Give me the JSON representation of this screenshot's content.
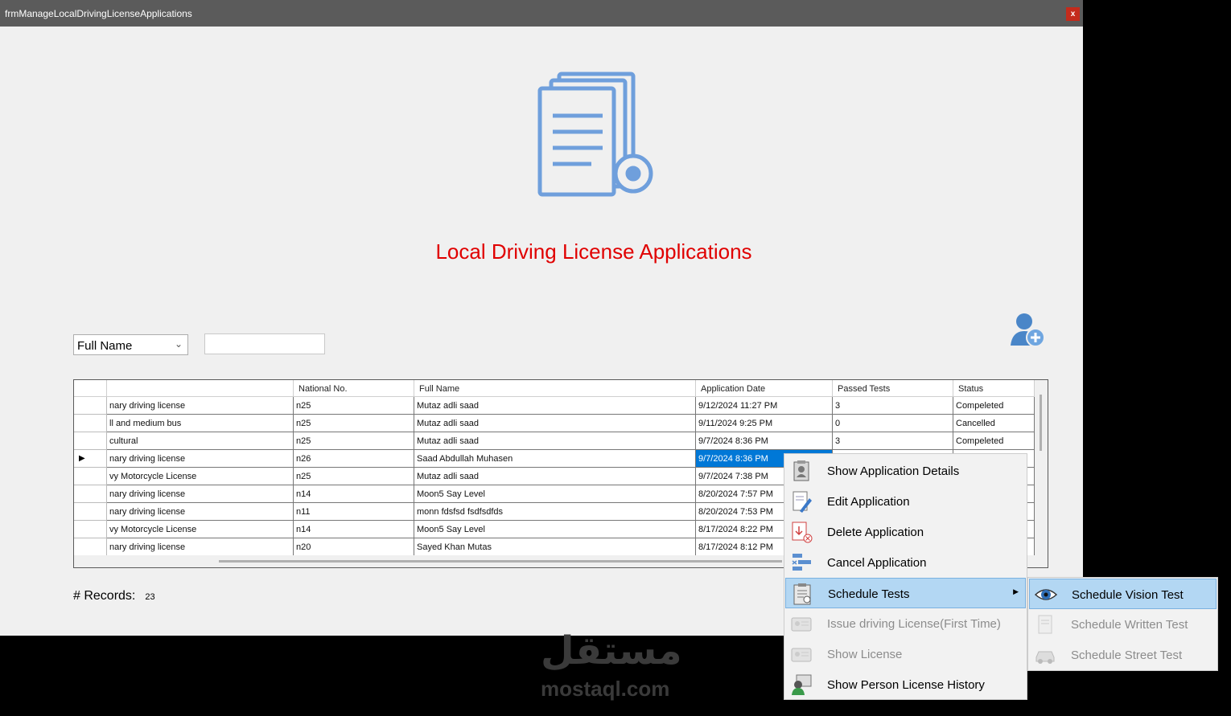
{
  "window": {
    "title": "frmManageLocalDrivingLicenseApplications",
    "close_label": "x"
  },
  "header": {
    "title": "Local Driving License Applications"
  },
  "filter": {
    "selected": "Full Name",
    "value": ""
  },
  "grid": {
    "columns": [
      "",
      "National No.",
      "Full Name",
      "Application Date",
      "Passed Tests",
      "Status"
    ],
    "rows": [
      {
        "marker": "",
        "class": "nary driving license",
        "national": "n25",
        "name": "Mutaz adli  saad",
        "date": "9/12/2024 11:27 PM",
        "passed": "3",
        "status": "Compeleted"
      },
      {
        "marker": "",
        "class": "ll and medium bus",
        "national": "n25",
        "name": "Mutaz adli  saad",
        "date": "9/11/2024 9:25 PM",
        "passed": "0",
        "status": "Cancelled"
      },
      {
        "marker": "",
        "class": "cultural",
        "national": "n25",
        "name": "Mutaz adli  saad",
        "date": "9/7/2024 8:36 PM",
        "passed": "3",
        "status": "Compeleted"
      },
      {
        "marker": "▶",
        "class": "nary driving license",
        "national": "n26",
        "name": "Saad Abdullah  Muhasen",
        "date": "9/7/2024 8:36 PM",
        "passed": "",
        "status": ""
      },
      {
        "marker": "",
        "class": "vy Motorcycle License",
        "national": "n25",
        "name": "Mutaz adli  saad",
        "date": "9/7/2024 7:38 PM",
        "passed": "",
        "status": ""
      },
      {
        "marker": "",
        "class": "nary driving license",
        "national": "n14",
        "name": "Moon5 Say  Level",
        "date": "8/20/2024 7:57 PM",
        "passed": "",
        "status": ""
      },
      {
        "marker": "",
        "class": "nary driving license",
        "national": "n11",
        "name": "monn fdsfsd  fsdfsdfds",
        "date": "8/20/2024 7:53 PM",
        "passed": "",
        "status": ""
      },
      {
        "marker": "",
        "class": "vy Motorcycle License",
        "national": "n14",
        "name": "Moon5 Say  Level",
        "date": "8/17/2024 8:22 PM",
        "passed": "",
        "status": ""
      },
      {
        "marker": "",
        "class": "nary driving license",
        "national": "n20",
        "name": "Sayed Khan  Mutas",
        "date": "8/17/2024 8:12 PM",
        "passed": "",
        "status": ""
      }
    ]
  },
  "records": {
    "label": "# Records:",
    "count": "23"
  },
  "context_menu": {
    "items": [
      {
        "label": "Show Application Details",
        "icon": "id-card-icon",
        "enabled": true
      },
      {
        "label": "Edit Application",
        "icon": "edit-document-icon",
        "enabled": true
      },
      {
        "label": "Delete Application",
        "icon": "delete-document-icon",
        "enabled": true
      },
      {
        "label": "Cancel  Application",
        "icon": "cancel-list-icon",
        "enabled": true
      },
      {
        "label": "Schedule Tests",
        "icon": "schedule-clipboard-icon",
        "enabled": true,
        "highlighted": true
      },
      {
        "label": "Issue driving License(First Time)",
        "icon": "license-card-icon",
        "enabled": false
      },
      {
        "label": "Show License",
        "icon": "license-card-icon",
        "enabled": false
      },
      {
        "label": "Show Person License History",
        "icon": "person-history-icon",
        "enabled": true
      }
    ]
  },
  "submenu": {
    "items": [
      {
        "label": "Schedule Vision Test",
        "icon": "eye-icon",
        "enabled": true,
        "highlighted": true
      },
      {
        "label": "Schedule Written Test",
        "icon": "written-test-icon",
        "enabled": false
      },
      {
        "label": "Schedule Street Test",
        "icon": "car-icon",
        "enabled": false
      }
    ]
  },
  "watermark": {
    "arabic": "مستقل",
    "text": "mostaql.com"
  },
  "colors": {
    "title_red": "#e00000",
    "selection_blue": "#0078d7",
    "menu_highlight": "#b3d7f3"
  }
}
